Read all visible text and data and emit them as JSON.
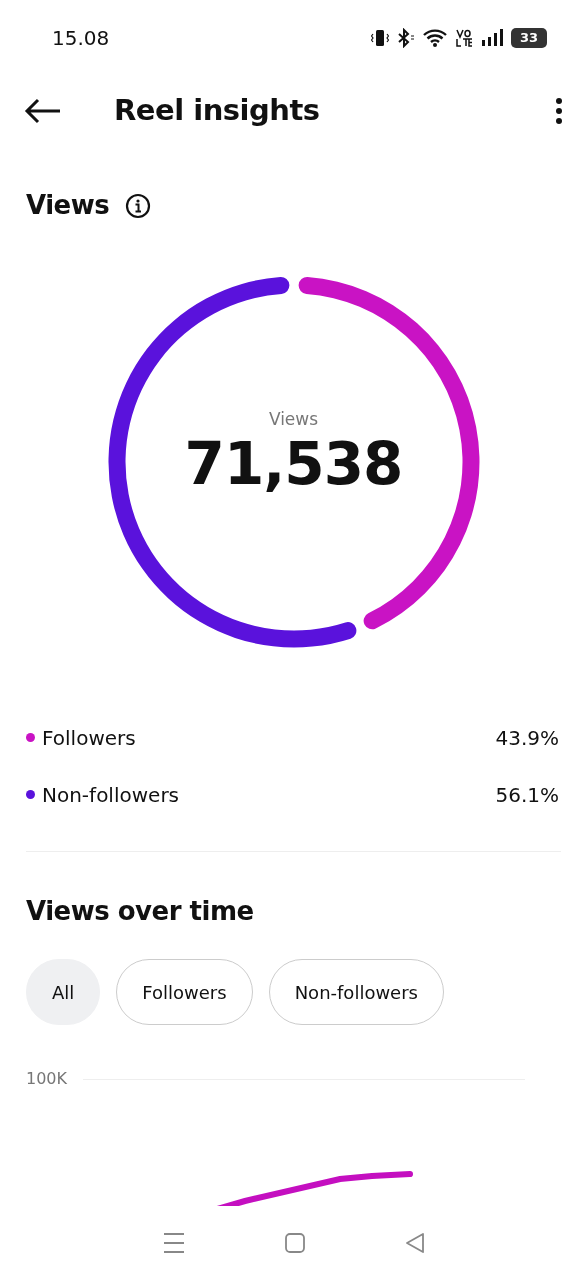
{
  "status_bar": {
    "time": "15.08",
    "battery": "33"
  },
  "header": {
    "title": "Reel insights"
  },
  "views_section": {
    "title": "Views",
    "chart_data": {
      "type": "donut",
      "categories": [
        "Followers",
        "Non-followers"
      ],
      "values": [
        43.9,
        56.1
      ]
    },
    "center_label": "Views",
    "center_value": "71,538",
    "legend": [
      {
        "value": "43.9%",
        "color": "#c913c4"
      },
      {
        "value": "56.1%",
        "color": "#5a12dc"
      }
    ]
  },
  "views_over_time": {
    "title": "Views over time",
    "filters": [
      {
        "label": "All",
        "selected": true
      },
      {
        "label": "Followers",
        "selected": false
      },
      {
        "label": "Non-followers",
        "selected": false
      }
    ],
    "axis_label": "100K"
  }
}
